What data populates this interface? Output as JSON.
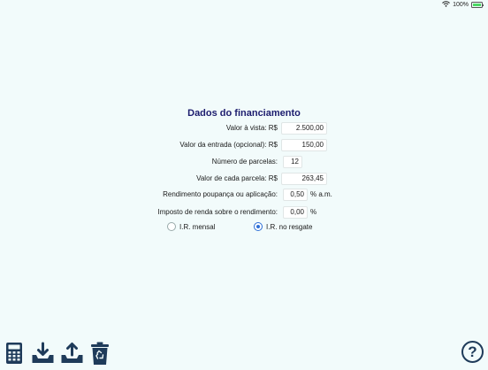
{
  "status": {
    "battery_text": "100%"
  },
  "form": {
    "title": "Dados do financiamento",
    "fields": {
      "valor_vista": {
        "label": "Valor à vista: R$",
        "value": "2.500,00"
      },
      "valor_entrada": {
        "label": "Valor da entrada (opcional): R$",
        "value": "150,00"
      },
      "num_parcelas": {
        "label": "Número de parcelas:",
        "value": "12"
      },
      "valor_parcela": {
        "label": "Valor de cada parcela: R$",
        "value": "263,45"
      },
      "rendimento": {
        "label": "Rendimento poupança ou aplicação:",
        "value": "0,50",
        "suffix": "% a.m."
      },
      "imposto": {
        "label": "Imposto de renda sobre o rendimento:",
        "value": "0,00",
        "suffix": "%"
      }
    },
    "ir_options": {
      "mensal": {
        "label": "I.R. mensal",
        "selected": false
      },
      "resgate": {
        "label": "I.R. no resgate",
        "selected": true
      }
    }
  },
  "toolbar": {
    "help_label": "?"
  },
  "icons": [
    "wifi-icon",
    "battery-icon",
    "calculator-icon",
    "download-tray-icon",
    "upload-tray-icon",
    "recycle-bin-icon",
    "help-icon"
  ],
  "colors": {
    "background": "#f2fbfb",
    "title": "#1c1c6e",
    "accent": "#2d6fd6",
    "toolbar_icons": "#1f3b5a"
  }
}
